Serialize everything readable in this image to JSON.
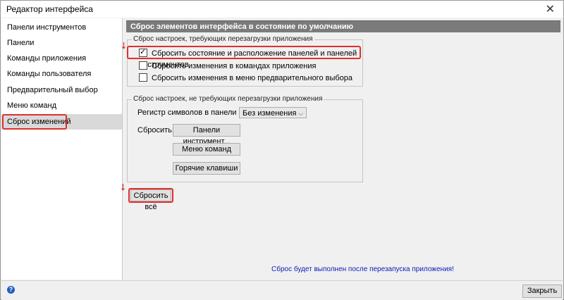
{
  "window": {
    "title": "Редактор интерфейса",
    "close_glyph": "✕"
  },
  "sidebar": {
    "items": [
      {
        "label": "Панели инструментов"
      },
      {
        "label": "Панели"
      },
      {
        "label": "Команды приложения"
      },
      {
        "label": "Команды пользователя"
      },
      {
        "label": "Предварительный выбор"
      },
      {
        "label": "Меню команд"
      },
      {
        "label": "Сброс изменений",
        "selected": true
      }
    ]
  },
  "main": {
    "header": "Сброс элементов интерфейса в состояние по умолчанию",
    "restart_group": {
      "label": "Сброс настроек, требующих перезагрузки приложения",
      "options": [
        {
          "label": "Сбросить состояние и расположение панелей и панелей инструментов",
          "checked": true
        },
        {
          "label": "Сбросить изменения в командах приложения",
          "checked": false
        },
        {
          "label": "Сбросить изменения в меню предварительного выбора",
          "checked": false
        }
      ]
    },
    "norestart_group": {
      "label": "Сброс настроек, не требующих перезагрузки приложения",
      "case_label": "Регистр символов в панели меню:",
      "case_value": "Без изменения",
      "reset_label": "Сбросить:",
      "buttons": {
        "toolbars": "Панели инструмент...",
        "menu": "Меню команд",
        "hotkeys": "Горячие клавиши"
      }
    },
    "reset_all": "Сбросить всё",
    "note": "Сброс будет выполнен после перезапуска приложения!"
  },
  "footer": {
    "help_glyph": "?",
    "close_label": "Закрыть"
  },
  "colors": {
    "highlight": "#e0302c",
    "header_bg": "#7b7b7b",
    "note": "#0d18b4",
    "selected": "#d9d9d9"
  },
  "icons": {
    "close": "close-icon",
    "help": "help-icon",
    "checkbox": "checkbox-icon",
    "dropdown": "chevron-down-icon",
    "pointer": "arrow-icon"
  }
}
